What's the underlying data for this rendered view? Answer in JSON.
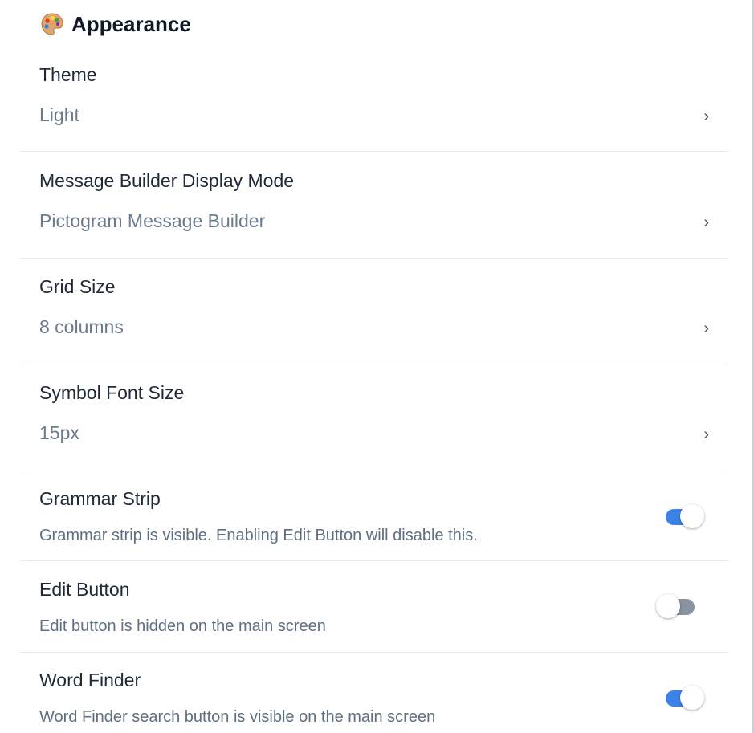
{
  "section": {
    "icon": "palette-icon",
    "title": "Appearance"
  },
  "settings": [
    {
      "label": "Theme",
      "value": "Light",
      "control": "chevron",
      "chevron": "›"
    },
    {
      "label": "Message Builder Display Mode",
      "value": "Pictogram Message Builder",
      "control": "chevron",
      "chevron": "›"
    },
    {
      "label": "Grid Size",
      "value": "8 columns",
      "control": "chevron",
      "chevron": "›"
    },
    {
      "label": "Symbol Font Size",
      "value": "15px",
      "control": "chevron",
      "chevron": "›"
    },
    {
      "label": "Grammar Strip",
      "description": "Grammar strip is visible. Enabling Edit Button will disable this.",
      "control": "toggle",
      "enabled": true
    },
    {
      "label": "Edit Button",
      "description": "Edit button is hidden on the main screen",
      "control": "toggle",
      "enabled": false
    },
    {
      "label": "Word Finder",
      "description": "Word Finder search button is visible on the main screen",
      "control": "toggle",
      "enabled": true
    }
  ],
  "colors": {
    "toggle_on": "#3b82e6",
    "toggle_off": "#8a93a0",
    "label": "#1f2937",
    "secondary": "#6b7a8d"
  }
}
